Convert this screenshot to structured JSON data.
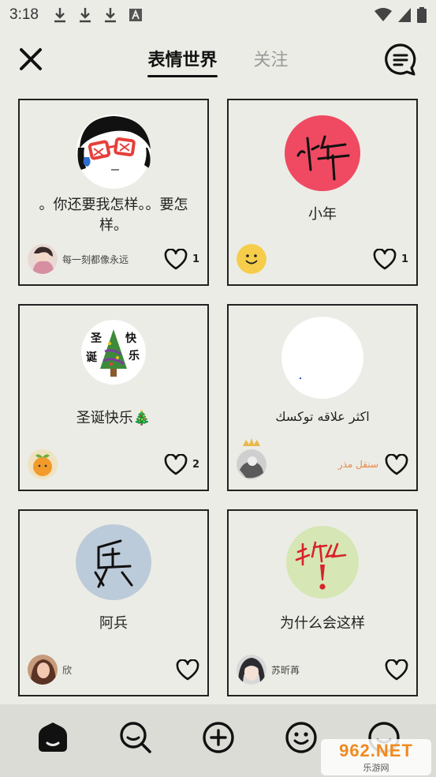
{
  "status_bar": {
    "time": "3:18"
  },
  "header": {
    "tabs": [
      {
        "label": "表情世界",
        "active": true
      },
      {
        "label": "关注",
        "active": false
      }
    ]
  },
  "cards": [
    {
      "title": "。你还要我怎样。。要怎样。",
      "art": "glasses-face",
      "username": "每一刻都像永远",
      "likes": "1",
      "user_avatar": "girl-photo"
    },
    {
      "title": "小年",
      "art": "red-circle-xiaonian",
      "username": "",
      "likes": "1",
      "user_avatar": "yellow-smiley"
    },
    {
      "title": "圣诞快乐🎄",
      "art": "christmas-tree",
      "username": "",
      "likes": "2",
      "user_avatar": "orange-fruit"
    },
    {
      "title": "اكثر علاقه توكسك",
      "art": "white-circle",
      "username": "سنقل مذر",
      "likes": "",
      "user_avatar": "crown-photo"
    },
    {
      "title": "阿兵",
      "art": "blue-circle-bing",
      "username": "欣",
      "likes": "",
      "user_avatar": "girl-photo-2"
    },
    {
      "title": "为什么会这样",
      "art": "green-circle-weishenme",
      "username": "苏昕苒",
      "likes": "",
      "user_avatar": "anime-girl"
    }
  ],
  "bottom_nav": [
    {
      "name": "home",
      "active": true
    },
    {
      "name": "search"
    },
    {
      "name": "create"
    },
    {
      "name": "emoji"
    },
    {
      "name": "profile"
    }
  ],
  "watermark": {
    "top": "962.NET",
    "bottom": "乐游网"
  },
  "colors": {
    "background": "#ecece6",
    "nav_bg": "#dcdcd6",
    "accent_red": "#ef4a62",
    "rtl_username": "#e8894a"
  }
}
